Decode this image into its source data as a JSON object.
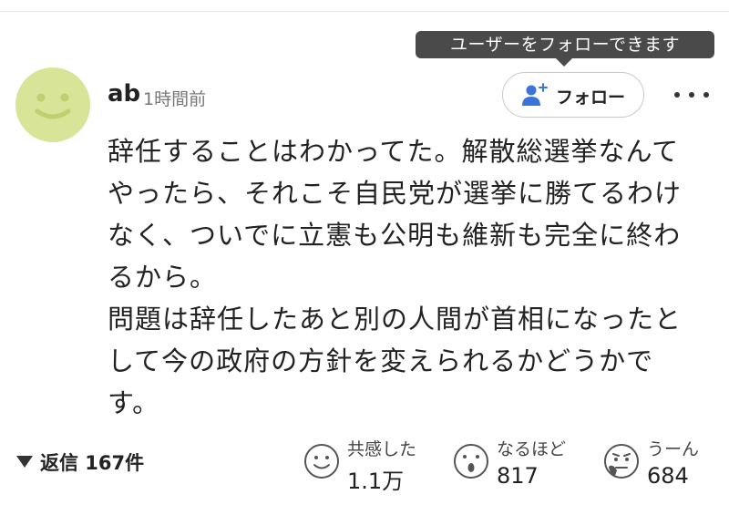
{
  "tooltip": {
    "text": "ユーザーをフォローできます"
  },
  "comment": {
    "username": "ab",
    "timestamp": "1時間前",
    "follow_label": "フォロー",
    "lines": [
      "辞任することはわかってた。解散総選挙なんて",
      "やったら、それこそ自民党が選挙に勝てるわけ",
      "なく、ついでに立憲も公明も維新も完全に終わ",
      "るから。",
      "問題は辞任したあと別の人間が首相になったと",
      "して今の政府の方針を変えられるかどうかで",
      "す。"
    ]
  },
  "footer": {
    "replies_label": "返信 167件",
    "reactions": [
      {
        "label": "共感した",
        "count": "1.1万",
        "icon": "smile-face-icon"
      },
      {
        "label": "なるほど",
        "count": "817",
        "icon": "surprised-face-icon"
      },
      {
        "label": "うーん",
        "count": "684",
        "icon": "thinking-face-icon"
      }
    ]
  },
  "colors": {
    "avatar": "#d8e497",
    "tooltip_bg": "#4a4a4a",
    "follow_icon": "#3a73d9"
  }
}
